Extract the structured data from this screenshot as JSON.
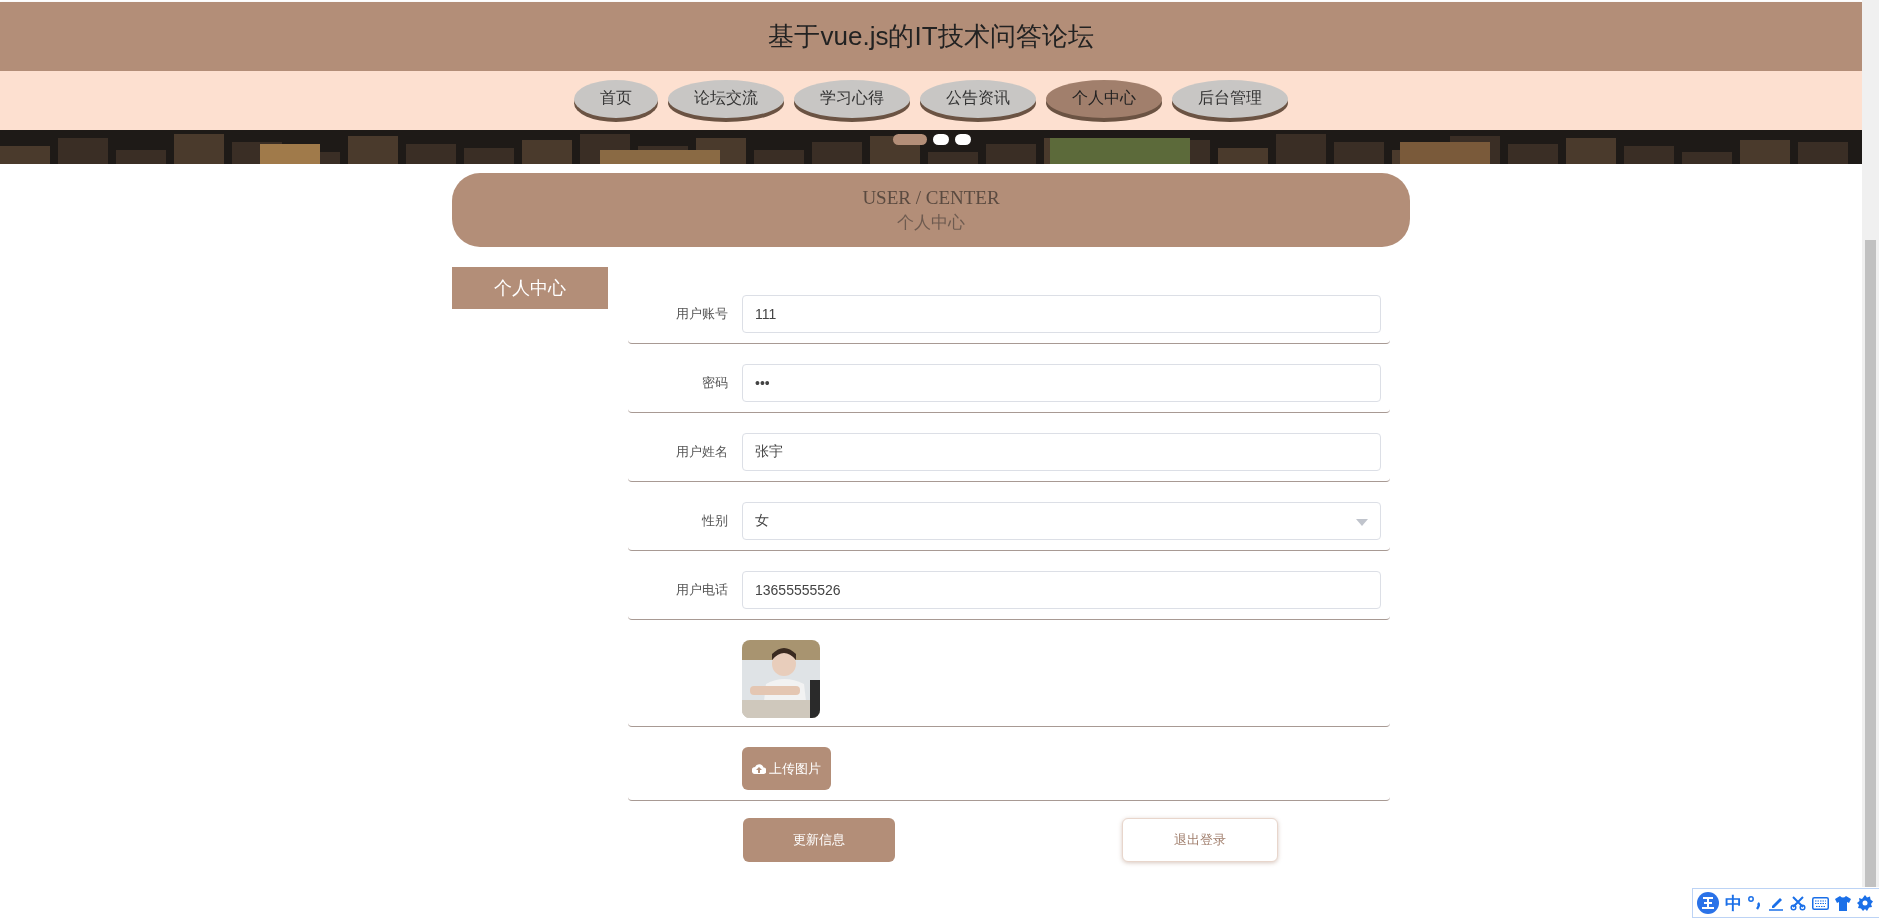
{
  "site_title": "基于vue.js的IT技术问答论坛",
  "nav": [
    {
      "label": "首页",
      "selected": false
    },
    {
      "label": "论坛交流",
      "selected": false
    },
    {
      "label": "学习心得",
      "selected": false
    },
    {
      "label": "公告资讯",
      "selected": false
    },
    {
      "label": "个人中心",
      "selected": true
    },
    {
      "label": "后台管理",
      "selected": false
    }
  ],
  "carousel_dots": [
    {
      "selected": true
    },
    {
      "selected": false
    },
    {
      "selected": false
    }
  ],
  "section_banner": {
    "title_en": "USER / CENTER",
    "title_zh": "个人中心"
  },
  "sidebar": {
    "items": [
      {
        "label": "个人中心",
        "selected": true
      }
    ]
  },
  "form": {
    "fields": [
      {
        "label": "用户账号",
        "kind": "text",
        "value": "111"
      },
      {
        "label": "密码",
        "kind": "password",
        "value": "•••"
      },
      {
        "label": "用户姓名",
        "kind": "text",
        "value": "张宇"
      },
      {
        "label": "性别",
        "kind": "select",
        "value": "女"
      },
      {
        "label": "用户电话",
        "kind": "text",
        "value": "13655555526"
      }
    ],
    "upload_button": "上传图片",
    "buttons": [
      {
        "label": "更新信息",
        "kind": "primary"
      },
      {
        "label": "退出登录",
        "kind": "secondary"
      }
    ]
  },
  "ime_toolbar": {
    "mode": "中"
  }
}
